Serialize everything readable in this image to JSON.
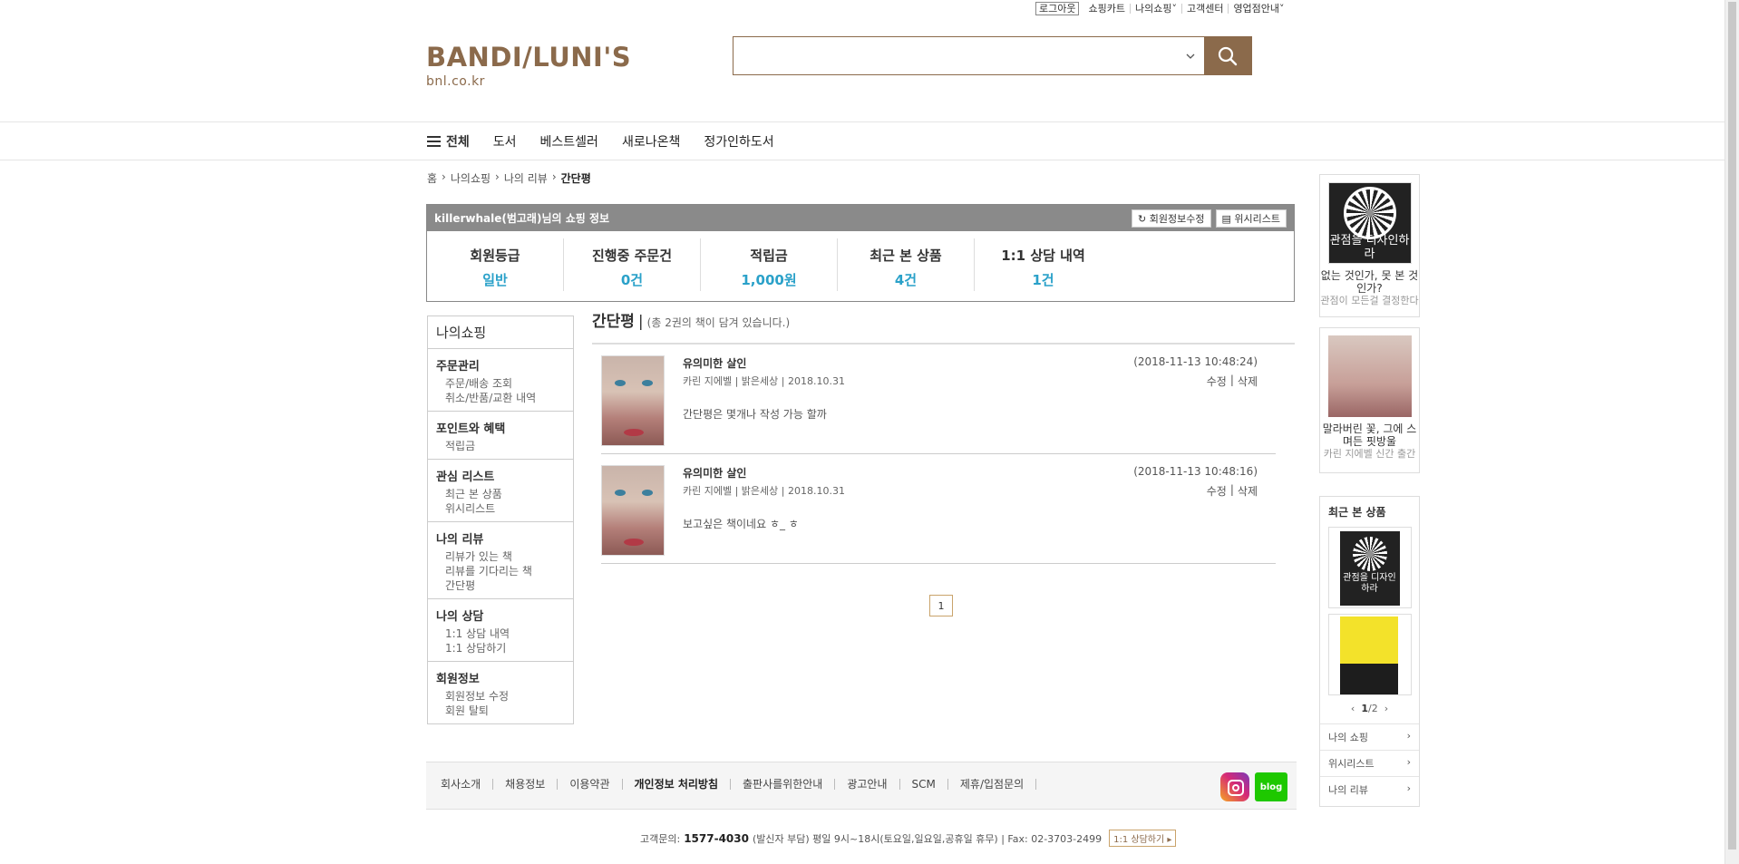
{
  "util": {
    "logout": "로그아웃",
    "cart": "쇼핑카트",
    "my_shopping": "나의쇼핑",
    "customer_center": "고객센터",
    "stores": "영업점안내"
  },
  "brand": {
    "logo": "BANDI/LUNI'S",
    "url": "bnl.co.kr"
  },
  "search": {
    "value": "",
    "placeholder": ""
  },
  "gnb": {
    "all": "전체",
    "items": [
      "도서",
      "베스트셀러",
      "새로나온책",
      "정가인하도서"
    ]
  },
  "breadcrumb": [
    "홈",
    "나의쇼핑",
    "나의 리뷰",
    "간단평"
  ],
  "shopinfo": {
    "title": "killerwhale(범고래)님의 쇼핑 정보",
    "edit_btn": "회원정보수정",
    "wish_btn": "위시리스트",
    "stats": [
      {
        "label": "회원등급",
        "value": "일반"
      },
      {
        "label": "진행중 주문건",
        "value": "0건"
      },
      {
        "label": "적립금",
        "value": "1,000원"
      },
      {
        "label": "최근 본 상품",
        "value": "4건"
      },
      {
        "label": "1:1 상담 내역",
        "value": "1건"
      }
    ]
  },
  "lnb": {
    "title": "나의쇼핑",
    "groups": [
      {
        "title": "주문관리",
        "items": [
          "주문/배송 조회",
          "취소/반품/교환 내역"
        ]
      },
      {
        "title": "포인트와 혜택",
        "items": [
          "적립금"
        ]
      },
      {
        "title": "관심 리스트",
        "items": [
          "최근 본 상품",
          "위시리스트"
        ]
      },
      {
        "title": "나의 리뷰",
        "items": [
          "리뷰가 있는 책",
          "리뷰를 기다리는 책",
          "간단평"
        ]
      },
      {
        "title": "나의 상담",
        "items": [
          "1:1 상담 내역",
          "1:1 상담하기"
        ]
      },
      {
        "title": "회원정보",
        "items": [
          "회원정보 수정",
          "회원 탈퇴"
        ]
      }
    ]
  },
  "content": {
    "title": "간단평",
    "bar": "|",
    "count": "(총 2권의 책이 담겨 있습니다.)",
    "reviews": [
      {
        "title": "유의미한 살인",
        "meta": "카린 지에벨 | 밝은세상 | 2018.10.31",
        "text": "간단평은 몇개나 작성 가능 할까",
        "date": "(2018-11-13 10:48:24)",
        "edit": "수정",
        "sep": "|",
        "del": "삭제"
      },
      {
        "title": "유의미한 살인",
        "meta": "카린 지에벨 | 밝은세상 | 2018.10.31",
        "text": "보고싶은 책이네요 ㅎ_ ㅎ",
        "date": "(2018-11-13 10:48:16)",
        "edit": "수정",
        "sep": "|",
        "del": "삭제"
      }
    ],
    "page": "1"
  },
  "side": {
    "ad1": {
      "cover_text": "관점을 디자인하라",
      "line1": "없는 것인가, 못 본 것인가?",
      "line2": "관점이 모든걸 결정한다"
    },
    "ad2": {
      "line1": "말라버린 꽃, 그에 스며든 핏방울",
      "line2": "카린 지에벨 신간 출간"
    },
    "recent_title": "최근 본 상품",
    "recent_cover1": "관점을 디자인하라",
    "pager": {
      "prev": "‹",
      "current": "1",
      "sep": "/",
      "total": "2",
      "next": "›"
    },
    "links": [
      "나의 쇼핑",
      "위시리스트",
      "나의 리뷰"
    ]
  },
  "footer": {
    "links": [
      "회사소개",
      "채용정보",
      "이용약관",
      "개인정보 처리방침",
      "출판사를위한안내",
      "광고안내",
      "SCM",
      "제휴/입점문의"
    ],
    "blog": "blog",
    "cs_label": "고객문의:",
    "cs_number": "1577-4030",
    "cs_info": "(발신자 부담) 평일 9시~18시(토요일,일요일,공휴일 휴무) | Fax: 02-3703-2499",
    "chat_btn": "1:1 상담하기 ▸"
  }
}
